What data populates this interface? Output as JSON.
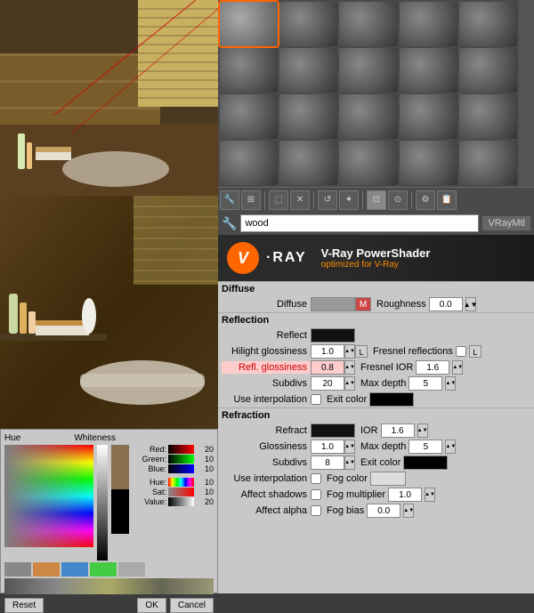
{
  "app": {
    "title": "V-Ray PowerShader"
  },
  "render": {
    "scene_desc": "Interior bathroom scene"
  },
  "toolbar": {
    "buttons": [
      "✎",
      "⊞",
      "✂",
      "✕",
      "↺",
      "✦",
      "⊡",
      "⊙",
      "!"
    ],
    "active_index": 6
  },
  "name_row": {
    "icon": "🔧",
    "material_name": "wood",
    "material_type": "VRayMtl"
  },
  "vray": {
    "logo_v": "V",
    "logo_ray": "·RAY",
    "title": "V-Ray PowerShader",
    "subtitle": "optimized for V-Ray"
  },
  "diffuse": {
    "label": "Diffuse",
    "swatch_color": "#999999",
    "m_button": "M",
    "roughness_label": "Roughness",
    "roughness_value": "0.0"
  },
  "reflection": {
    "label": "Reflection",
    "reflect_label": "Reflect",
    "swatch_color": "#111111",
    "hilight_gloss_label": "Hilight glossiness",
    "hilight_gloss_value": "1.0",
    "l_button": "L",
    "fresnel_label": "Fresnel reflections",
    "fresnel_l": "L",
    "refl_gloss_label": "Refl. glossiness",
    "refl_gloss_value": "0.8",
    "fresnel_ior_label": "Fresnel IOR",
    "fresnel_ior_value": "1.6",
    "subdivs_label": "Subdivs",
    "subdivs_value": "20",
    "max_depth_label": "Max depth",
    "max_depth_value": "5",
    "use_interp_label": "Use interpolation",
    "exit_color_label": "Exit color"
  },
  "refraction": {
    "label": "Refraction",
    "refract_label": "Refract",
    "ior_label": "IOR",
    "ior_value": "1.6",
    "glossiness_label": "Glossiness",
    "glossiness_value": "1.0",
    "max_depth_label": "Max depth",
    "max_depth_value": "5",
    "subdivs_label": "Subdivs",
    "subdivs_value": "8",
    "exit_color_label": "Exit color",
    "use_interp_label": "Use interpolation",
    "fog_color_label": "Fog color",
    "affect_shadows_label": "Affect shadows",
    "fog_multiplier_label": "Fog multiplier",
    "fog_multiplier_value": "1.0",
    "affect_alpha_label": "Affect alpha",
    "fog_bias_label": "Fog bias",
    "fog_bias_value": "0.0"
  },
  "color_picker": {
    "hue_label": "Hue",
    "whiteness_label": "Whiteness",
    "red_label": "Red:",
    "green_label": "Green:",
    "blue_label": "Blue:",
    "hue_label2": "Hue:",
    "sat_label": "Sat:",
    "val_label": "Value:",
    "red_value": "20",
    "green_value": "10",
    "blue_value": "10",
    "hue_value": "10",
    "sat_value": "10",
    "val_value": "20",
    "reset_label": "Reset",
    "ok_label": "OK",
    "cancel_label": "Cancel"
  },
  "materials": {
    "count": 20,
    "selected": 0
  }
}
